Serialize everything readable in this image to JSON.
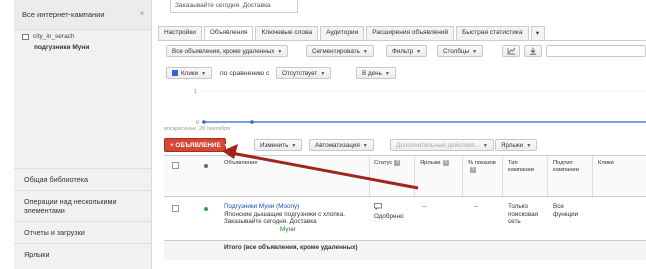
{
  "sidebar": {
    "header": "Все интернет-кампании",
    "collapse_icon": "«",
    "campaign": "city_in_serach",
    "group": "подгузники Муни",
    "bottom_items": [
      {
        "label": "Общая библиотека"
      },
      {
        "label": "Операции над несколькими элементами"
      },
      {
        "label": "Отчеты и загрузки"
      },
      {
        "label": "Ярлыки"
      }
    ]
  },
  "topfield": "Заказывайте сегодня. Доставка",
  "tabs": [
    {
      "label": "Настройки"
    },
    {
      "label": "Объявления"
    },
    {
      "label": "Ключевые слова"
    },
    {
      "label": "Аудитории"
    },
    {
      "label": "Расширения объявлений"
    },
    {
      "label": "Быстрая статистика"
    }
  ],
  "tab_more": "▾",
  "filters": {
    "ads_filter": "Все объявления, кроме удаленных",
    "segment": "Сегментировать",
    "filter": "Фильтр",
    "columns": "Столбцы"
  },
  "metrics": {
    "metric": "Клики",
    "compare_label": "по сравнению с",
    "compare_value": "Отсутствует",
    "period": "В день"
  },
  "chart": {
    "y_tick": "1",
    "y_zero": "0",
    "x_label": "воскресенье, 28 сентября"
  },
  "toolbar": {
    "add": "+ ОБЪЯВЛЕНИЕ",
    "edit": "Изменить",
    "automation": "Автоматизация",
    "more_actions": "Дополнительные действия...",
    "labels": "Ярлыки"
  },
  "columns": {
    "ad": "Объявление",
    "status": "Статус",
    "labels": "Ярлыки",
    "impr_pct": "% показов",
    "campaign_type": "Тип кампании",
    "subtype": "Подтип кампании",
    "clicks": "Клики"
  },
  "row": {
    "title": "Подгузники Муни (Moony)",
    "line1": "Японские дышащие подгузники с хлопка.",
    "line2": "Заказывайте сегодня. Доставка",
    "url": "Муни",
    "status": "Одобрено",
    "labels": "--",
    "impr_pct": "--",
    "campaign_type": "Только поисковая сеть",
    "subtype": "Все функции"
  },
  "total": {
    "label": "Итого (все объявления, кроме удаленных)"
  }
}
